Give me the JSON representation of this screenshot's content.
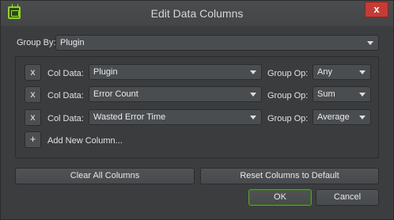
{
  "window": {
    "title": "Edit Data Columns",
    "close_label": "x"
  },
  "group_by": {
    "label": "Group By:",
    "value": "Plugin"
  },
  "columns": [
    {
      "remove": "x",
      "col_label": "Col Data:",
      "col_value": "Plugin",
      "op_label": "Group Op:",
      "op_value": "Any"
    },
    {
      "remove": "x",
      "col_label": "Col Data:",
      "col_value": "Error Count",
      "op_label": "Group Op:",
      "op_value": "Sum"
    },
    {
      "remove": "x",
      "col_label": "Col Data:",
      "col_value": "Wasted Error Time",
      "op_label": "Group Op:",
      "op_value": "Average"
    }
  ],
  "add_column": {
    "button": "+",
    "label": "Add New Column..."
  },
  "buttons": {
    "clear": "Clear All Columns",
    "reset": "Reset Columns to Default",
    "ok": "OK",
    "cancel": "Cancel"
  },
  "colors": {
    "accent": "#8fcf2f",
    "close": "#c43c35",
    "background": "#3b3d3f"
  },
  "icons": {
    "app": "app-window-icon",
    "close": "close-icon",
    "dropdown": "chevron-down-icon"
  }
}
